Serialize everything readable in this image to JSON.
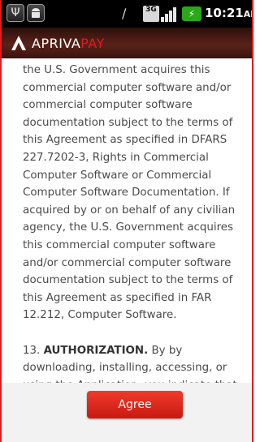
{
  "status_bar": {
    "icons": [
      "usb-icon",
      "android-icon",
      "signal-off-icon",
      "network-3g-icon",
      "signal-bars-icon",
      "battery-icon"
    ],
    "network_label": "3G",
    "time": "10:21",
    "ampm": "AM",
    "colors": {
      "battery": "#2aa81a",
      "background": "#000000"
    }
  },
  "header": {
    "brand_prefix": "APRIVA",
    "brand_suffix": "PAY",
    "colors": {
      "accent": "#e11b22"
    }
  },
  "agreement": {
    "para1": "the U.S. Government acquires this commercial computer software and/or commercial computer software documentation subject to the terms of this Agreement as specified in DFARS 227.7202-3, Rights in Commercial Computer Software or Commercial Computer Software Documentation. If acquired by or on behalf of any civilian agency, the U.S. Government acquires this commercial computer software and/or commercial computer software documentation subject to the terms of this Agreement as specified in FAR 12.212, Computer Software.",
    "para2_number": "13.",
    "para2_heading": "AUTHORIZATION.",
    "para2_body": "By by downloading, installing, accessing, or using the Application, you indicate that you have the authority to bind yourself and your organization to the terms of this Agreement."
  },
  "footer": {
    "agree_label": "Agree"
  }
}
